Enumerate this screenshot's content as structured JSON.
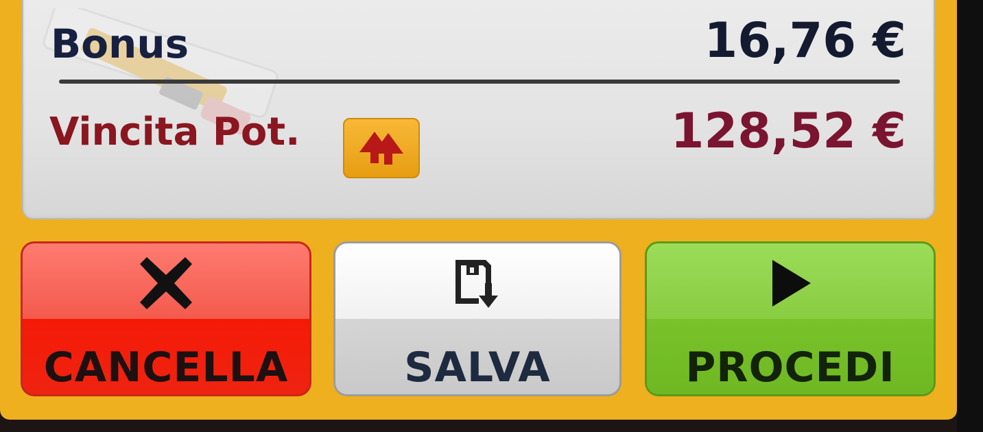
{
  "summary": {
    "bonus_label": "Bonus",
    "bonus_value": "16,76 €",
    "potential_win_label": "Vincita Pot.",
    "potential_win_value": "128,52 €"
  },
  "actions": {
    "cancel_label": "CANCELLA",
    "save_label": "SALVA",
    "proceed_label": "PROCEDI"
  },
  "icons": {
    "swap": "swap-arrows-icon",
    "cancel": "close-icon",
    "save": "save-disk-icon",
    "proceed": "play-icon"
  },
  "colors": {
    "panel": "#eeb01e",
    "cancel": "#f23020",
    "save": "#e8e8e8",
    "proceed": "#79c22a",
    "bonus_text": "#172040",
    "win_text": "#8a1620"
  }
}
